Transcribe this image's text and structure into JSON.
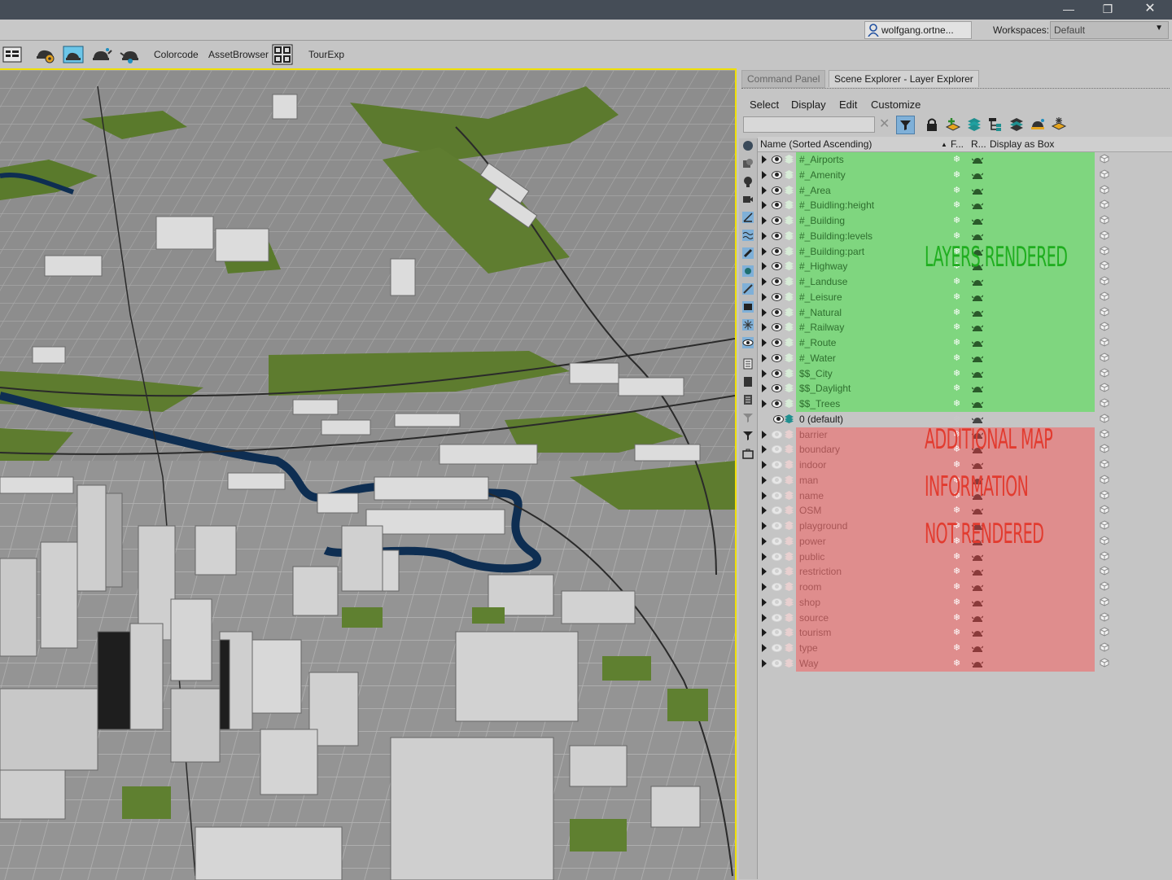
{
  "window": {
    "minimize": "—",
    "maximize": "❐",
    "close": "✕"
  },
  "account": {
    "user": "wolfgang.ortne...",
    "workspace_label": "Workspaces:",
    "workspace": "Default"
  },
  "toolbar": {
    "colorcode": "Colorcode",
    "asset_browser": "AssetBrowser",
    "tourexp": "TourExp"
  },
  "panel": {
    "tabs": [
      "Command Panel",
      "Scene Explorer - Layer Explorer"
    ],
    "menu": [
      "Select",
      "Display",
      "Edit",
      "Customize"
    ],
    "search_clear": "✕",
    "columns": {
      "name": "Name (Sorted Ascending)",
      "sort_arrow": "▲",
      "freeze": "F...",
      "render": "R...",
      "box": "Display as Box"
    }
  },
  "layers": [
    {
      "name": "#_Airports",
      "status": "rendered"
    },
    {
      "name": "#_Amenity",
      "status": "rendered"
    },
    {
      "name": "#_Area",
      "status": "rendered"
    },
    {
      "name": "#_Buidling:height",
      "status": "rendered"
    },
    {
      "name": "#_Building",
      "status": "rendered"
    },
    {
      "name": "#_Building:levels",
      "status": "rendered"
    },
    {
      "name": "#_Building:part",
      "status": "rendered"
    },
    {
      "name": "#_Highway",
      "status": "rendered"
    },
    {
      "name": "#_Landuse",
      "status": "rendered"
    },
    {
      "name": "#_Leisure",
      "status": "rendered"
    },
    {
      "name": "#_Natural",
      "status": "rendered"
    },
    {
      "name": "#_Railway",
      "status": "rendered"
    },
    {
      "name": "#_Route",
      "status": "rendered"
    },
    {
      "name": "#_Water",
      "status": "rendered"
    },
    {
      "name": "$$_City",
      "status": "rendered"
    },
    {
      "name": "$$_Daylight",
      "status": "rendered"
    },
    {
      "name": "$$_Trees",
      "status": "rendered"
    },
    {
      "name": "0 (default)",
      "status": "default"
    },
    {
      "name": "barrier",
      "status": "hidden"
    },
    {
      "name": "boundary",
      "status": "hidden"
    },
    {
      "name": "indoor",
      "status": "hidden"
    },
    {
      "name": "man",
      "status": "hidden"
    },
    {
      "name": "name",
      "status": "hidden"
    },
    {
      "name": "OSM",
      "status": "hidden"
    },
    {
      "name": "playground",
      "status": "hidden"
    },
    {
      "name": "power",
      "status": "hidden"
    },
    {
      "name": "public",
      "status": "hidden"
    },
    {
      "name": "restriction",
      "status": "hidden"
    },
    {
      "name": "room",
      "status": "hidden"
    },
    {
      "name": "shop",
      "status": "hidden"
    },
    {
      "name": "source",
      "status": "hidden"
    },
    {
      "name": "tourism",
      "status": "hidden"
    },
    {
      "name": "type",
      "status": "hidden"
    },
    {
      "name": "Way",
      "status": "hidden"
    }
  ],
  "annotations": {
    "rendered": "LAYERS RENDERED",
    "not_rendered": [
      "ADDITIONAL MAP",
      "INFORMATION",
      "NOT RENDERED"
    ]
  },
  "freeze_glyph": "❄",
  "colors": {
    "rendered": "#7fd67f",
    "not_rendered": "#df8d8d",
    "viewport_border": "#f0e000",
    "title_bar": "#454d57"
  },
  "icons": [
    "user-icon",
    "render-setup-icon",
    "render-frame-icon",
    "teapot-icon",
    "render-teapot-icon",
    "tourexp-icon",
    "layer-stack-icon",
    "lock-icon",
    "filter-icon",
    "eye-icon",
    "snowflake-icon",
    "box-icon"
  ]
}
